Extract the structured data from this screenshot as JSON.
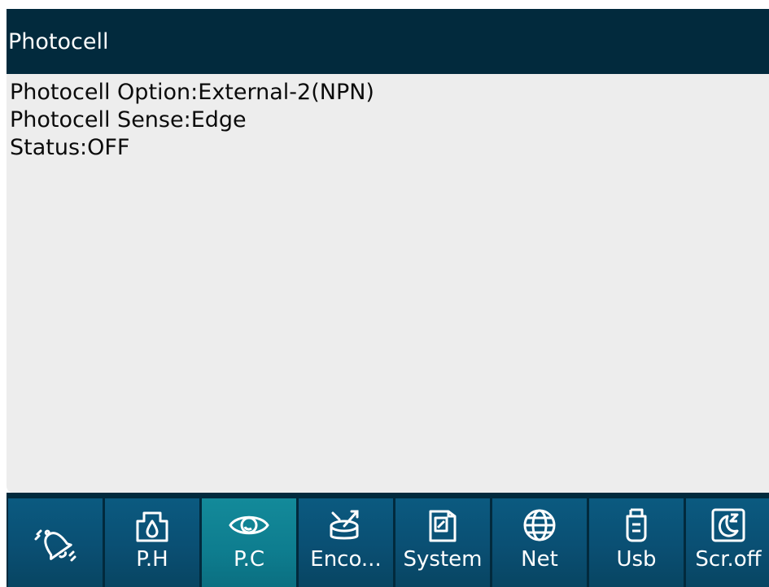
{
  "header": {
    "title": "Photocell"
  },
  "info": {
    "option": "Photocell Option:External-2(NPN)",
    "sense": "Photocell Sense:Edge",
    "status": "Status:OFF"
  },
  "tabs": [
    {
      "icon": "bell-icon",
      "label": ""
    },
    {
      "icon": "print-head-icon",
      "label": "P.H"
    },
    {
      "icon": "eye-icon",
      "label": "P.C"
    },
    {
      "icon": "encoder-icon",
      "label": "Enco..."
    },
    {
      "icon": "system-icon",
      "label": "System"
    },
    {
      "icon": "globe-icon",
      "label": "Net"
    },
    {
      "icon": "usb-icon",
      "label": "Usb"
    },
    {
      "icon": "moon-icon",
      "label": "Scr.off"
    }
  ],
  "active_tab": "P.C",
  "colors": {
    "header": "#022a3d",
    "tab": "#0a4f73",
    "tab_active": "#0e7d8f",
    "content_bg": "#ededed"
  }
}
